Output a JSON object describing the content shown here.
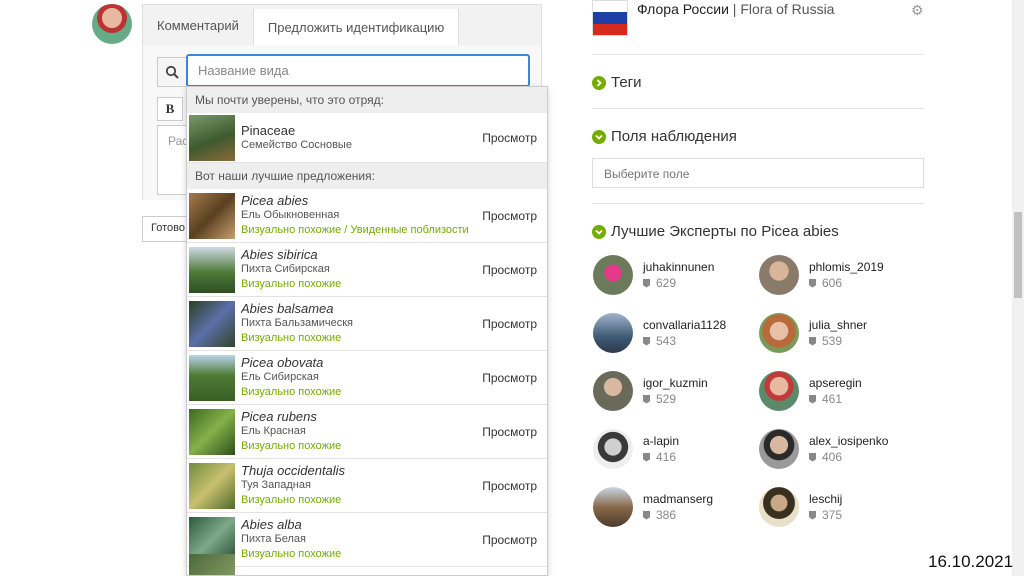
{
  "comment_panel": {
    "tab_comment": "Комментарий",
    "tab_suggest": "Предложить идентификацию",
    "search_placeholder": "Название вида",
    "bold_label": "B",
    "textarea_placeholder": "Рас",
    "done_button": "Готово"
  },
  "dropdown": {
    "top_heading": "Мы почти уверены, что это отряд:",
    "top_result": {
      "name": "Pinaceae",
      "common": "Семейство Сосновые",
      "view": "Просмотр"
    },
    "suggest_heading": "Вот наши лучшие предложения:",
    "results": [
      {
        "name": "Picea abies",
        "common": "Ель Обыкновенная",
        "match": "Визуально похожие / Увиденные поблизости",
        "view": "Просмотр"
      },
      {
        "name": "Abies sibirica",
        "common": "Пихта Сибирская",
        "match": "Визуально похожие",
        "view": "Просмотр"
      },
      {
        "name": "Abies balsamea",
        "common": "Пихта Бальзамическя",
        "match": "Визуально похожие",
        "view": "Просмотр"
      },
      {
        "name": "Picea obovata",
        "common": "Ель Сибирская",
        "match": "Визуально похожие",
        "view": "Просмотр"
      },
      {
        "name": "Picea rubens",
        "common": "Ель Красная",
        "match": "Визуально похожие",
        "view": "Просмотр"
      },
      {
        "name": "Thuja occidentalis",
        "common": "Туя Западная",
        "match": "Визуально похожие",
        "view": "Просмотр"
      },
      {
        "name": "Abies alba",
        "common": "Пихта Белая",
        "match": "Визуально похожие",
        "view": "Просмотр"
      }
    ]
  },
  "project": {
    "title_ru": "Флора России",
    "separator": "|",
    "title_en": "Flora of Russia"
  },
  "sections": {
    "tags": "Теги",
    "fields": "Поля наблюдения",
    "field_placeholder": "Выберите поле",
    "experts": "Лучшие Эксперты по Picea abies"
  },
  "experts": [
    {
      "login": "juhakinnunen",
      "count": "629"
    },
    {
      "login": "phlomis_2019",
      "count": "606"
    },
    {
      "login": "convallaria1128",
      "count": "543"
    },
    {
      "login": "julia_shner",
      "count": "539"
    },
    {
      "login": "igor_kuzmin",
      "count": "529"
    },
    {
      "login": "apseregin",
      "count": "461"
    },
    {
      "login": "a-lapin",
      "count": "416"
    },
    {
      "login": "alex_iosipenko",
      "count": "406"
    },
    {
      "login": "madmanserg",
      "count": "386"
    },
    {
      "login": "leschij",
      "count": "375"
    }
  ],
  "date": "16.10.2021",
  "colors": {
    "accent_green": "#74ac00",
    "focus_blue": "#3a87d9"
  }
}
